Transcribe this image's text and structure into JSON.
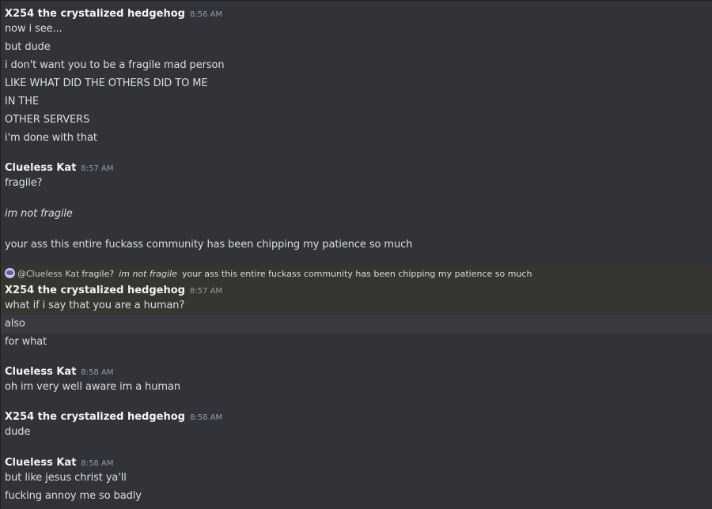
{
  "colors": {
    "background": "#313338",
    "reply_highlight": "#37352f",
    "hover_highlight": "#383a40",
    "author": "#f2f3f5",
    "timestamp": "#949ba4",
    "text": "#dbdee1"
  },
  "messages": [
    {
      "author": "X254 the crystalized hedgehog",
      "time": "8:56 AM",
      "lines": [
        "now i see...",
        "but dude",
        "i don't want you to be a fragile mad person",
        "LIKE WHAT DID THE OTHERS DID TO ME",
        "IN THE",
        "OTHER SERVERS",
        "i'm done with that"
      ]
    },
    {
      "author": "Clueless Kat",
      "time": "8:57 AM",
      "lines": [
        "fragile?",
        "im not fragile",
        "your ass this entire fuckass community has been chipping my patience so much"
      ]
    },
    {
      "reply": {
        "icon": "user-avatar-icon",
        "author": "@Clueless Kat",
        "text1": "fragile?",
        "text2": "im not fragile",
        "text3": "your ass this entire fuckass community has been chipping my patience so much"
      },
      "author": "X254 the crystalized hedgehog",
      "time": "8:57 AM",
      "lines": [
        "what if i say that you are a human?",
        "also",
        "for what"
      ]
    },
    {
      "author": "Clueless Kat",
      "time": "8:58 AM",
      "lines": [
        "oh im very well aware im a human"
      ]
    },
    {
      "author": "X254 the crystalized hedgehog",
      "time": "8:58 AM",
      "lines": [
        "dude"
      ]
    },
    {
      "author": "Clueless Kat",
      "time": "8:58 AM",
      "lines": [
        "but like jesus christ ya'll",
        "fucking annoy me so badly"
      ]
    }
  ]
}
